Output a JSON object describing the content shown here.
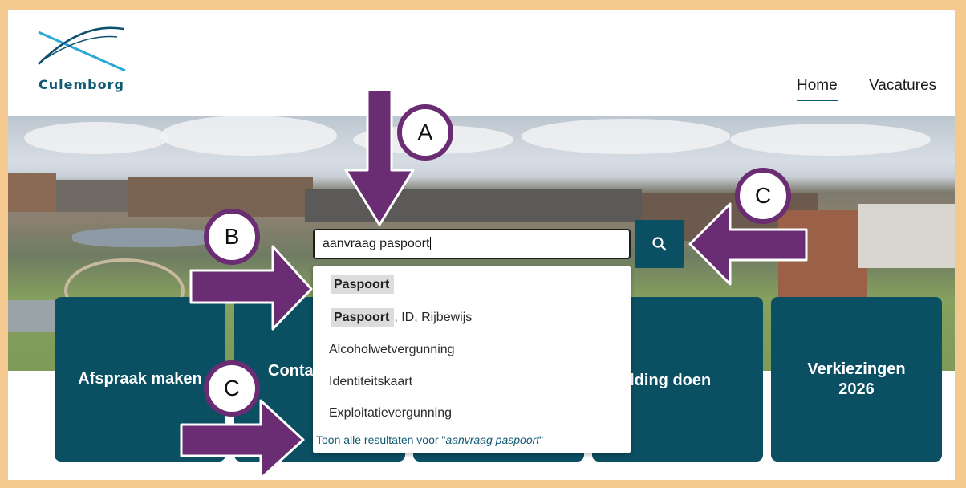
{
  "brand": {
    "logo_text": "Culemborg"
  },
  "nav": {
    "home": "Home",
    "vacatures": "Vacatures"
  },
  "search": {
    "value": "aanvraag paspoort",
    "button_icon": "search-icon"
  },
  "suggestions": {
    "item1_highlight": "Paspoort",
    "item2_highlight": "Paspoort",
    "item2_rest": ", ID, Rijbewijs",
    "item3": "Alcoholwetvergunning",
    "item4": "Identiteitskaart",
    "item5": "Exploitatievergunning",
    "show_all_prefix": "Toon alle resultaten voor \"",
    "show_all_query": "aanvraag paspoort",
    "show_all_suffix": "\""
  },
  "tiles": {
    "t1": "Afspraak maken",
    "t2": "Contact gemeente",
    "t2_visible": "Conta gem",
    "t4": "Melding doen",
    "t4_visible": "elding doen",
    "t5": "Verkiezingen 2026"
  },
  "annotations": {
    "a": "A",
    "b": "B",
    "c_top": "C",
    "c_bottom": "C"
  },
  "colors": {
    "brand_teal": "#0b4f62",
    "annotation_purple": "#6a2c72",
    "frame_orange": "#f3c98f"
  }
}
